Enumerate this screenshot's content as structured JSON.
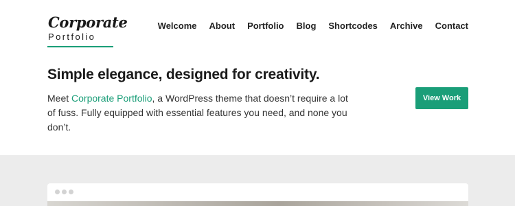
{
  "logo": {
    "script": "Corporate",
    "sub": "Portfolio"
  },
  "nav": {
    "items": [
      "Welcome",
      "About",
      "Portfolio",
      "Blog",
      "Shortcodes",
      "Archive",
      "Contact"
    ]
  },
  "hero": {
    "title": "Simple elegance, designed for creativity.",
    "text_before": "Meet ",
    "brand": "Corporate Portfolio",
    "text_after": ", a WordPress theme that doesn’t require a lot of fuss. Fully equipped with essential features you need, and none you don’t.",
    "button": "View Work"
  },
  "colors": {
    "accent": "#1a9e78",
    "band": "#ececec"
  }
}
